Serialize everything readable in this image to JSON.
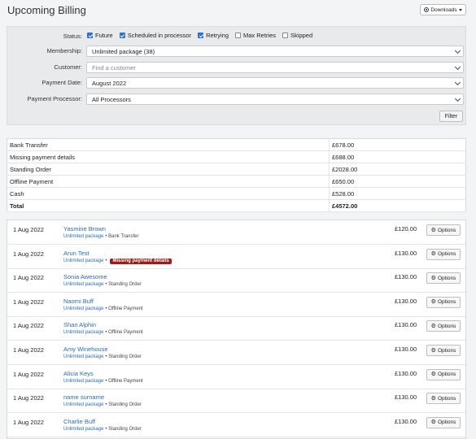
{
  "page": {
    "title": "Upcoming Billing"
  },
  "toolbar": {
    "downloads_label": "Downloads",
    "downloads_icon": "download-icon"
  },
  "filters": {
    "status_label": "Status:",
    "statuses": [
      {
        "label": "Future",
        "checked": true
      },
      {
        "label": "Scheduled in processor",
        "checked": true
      },
      {
        "label": "Retrying",
        "checked": true
      },
      {
        "label": "Max Retries",
        "checked": false
      },
      {
        "label": "Skipped",
        "checked": false
      }
    ],
    "membership_label": "Membership:",
    "membership_value": "Unlimited package (38)",
    "customer_label": "Customer:",
    "customer_placeholder": "Find a customer",
    "payment_date_label": "Payment Date:",
    "payment_date_value": "August 2022",
    "processor_label": "Payment Processor:",
    "processor_value": "All Processors",
    "filter_button": "Filter"
  },
  "summary": {
    "rows": [
      {
        "label": "Bank Transfer",
        "value": "£678.00"
      },
      {
        "label": "Missing payment details",
        "value": "£688.00"
      },
      {
        "label": "Standing Order",
        "value": "£2028.00"
      },
      {
        "label": "Offline Payment",
        "value": "£650.00"
      },
      {
        "label": "Cash",
        "value": "£528.00"
      }
    ],
    "total_label": "Total",
    "total_value": "£4572.00"
  },
  "bills": [
    {
      "date": "1 Aug 2022",
      "name": "Yasmine Brown",
      "package": "Unlimited package",
      "method": "• Bank Transfer",
      "badge": "",
      "amount": "£120.00",
      "options": "Options"
    },
    {
      "date": "1 Aug 2022",
      "name": "Arun Test",
      "package": "Unlimited package",
      "method": "•",
      "badge": "Missing payment details",
      "amount": "£130.00",
      "options": "Options"
    },
    {
      "date": "1 Aug 2022",
      "name": "Sonia Awesome",
      "package": "Unlimited package",
      "method": "• Standing Order",
      "badge": "",
      "amount": "£130.00",
      "options": "Options"
    },
    {
      "date": "1 Aug 2022",
      "name": "Naomi Buff",
      "package": "Unlimited package",
      "method": "• Offline Payment",
      "badge": "",
      "amount": "£130.00",
      "options": "Options"
    },
    {
      "date": "1 Aug 2022",
      "name": "Shan Alphin",
      "package": "Unlimited package",
      "method": "• Offline Payment",
      "badge": "",
      "amount": "£130.00",
      "options": "Options"
    },
    {
      "date": "1 Aug 2022",
      "name": "Amy Winehouse",
      "package": "Unlimited package",
      "method": "• Standing Order",
      "badge": "",
      "amount": "£130.00",
      "options": "Options"
    },
    {
      "date": "1 Aug 2022",
      "name": "Alicia Keys",
      "package": "Unlimited package",
      "method": "• Offline Payment",
      "badge": "",
      "amount": "£130.00",
      "options": "Options"
    },
    {
      "date": "1 Aug 2022",
      "name": "name surname",
      "package": "Unlimited package",
      "method": "• Standing Order",
      "badge": "",
      "amount": "£130.00",
      "options": "Options"
    },
    {
      "date": "1 Aug 2022",
      "name": "Charlie Buff",
      "package": "Unlimited package",
      "method": "• Standing Order",
      "badge": "",
      "amount": "£130.00",
      "options": "Options"
    }
  ],
  "colors": {
    "link": "#2b6cb0",
    "badge": "#9b1c1c",
    "check": "#2f6fd0"
  }
}
